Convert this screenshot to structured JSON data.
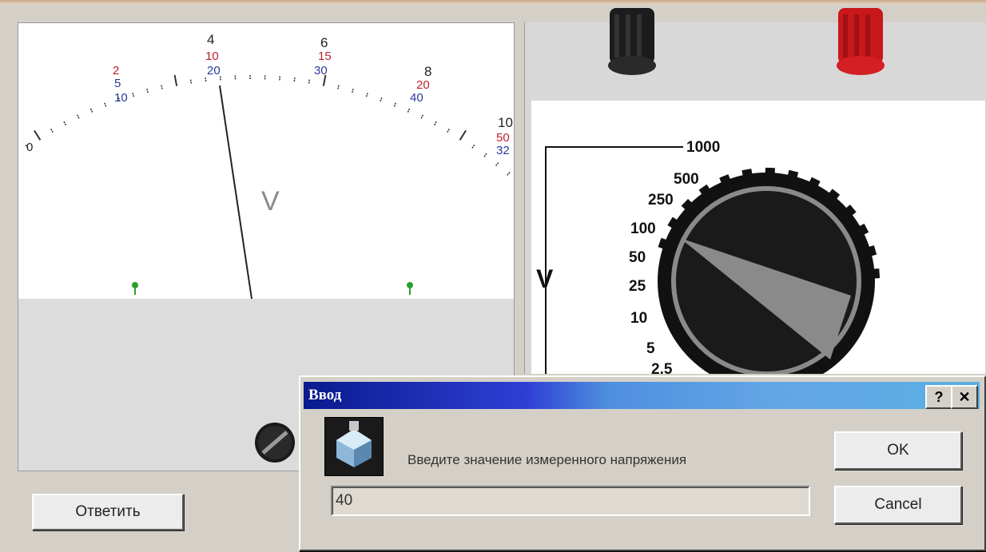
{
  "meter": {
    "unit_label": "V",
    "scales": [
      {
        "name": "top",
        "color": "#222222",
        "ticks": [
          "4",
          "6",
          "8",
          "10"
        ]
      },
      {
        "name": "middle",
        "color": "#c0202a",
        "ticks": [
          "2",
          "10",
          "15",
          "20",
          "50"
        ]
      },
      {
        "name": "inner",
        "color": "#2a3a9a",
        "ticks": [
          "5",
          "10",
          "20",
          "30",
          "40",
          "32"
        ]
      }
    ],
    "zero_label": "0",
    "needle_value": 20,
    "answer_button": "Ответить"
  },
  "switch": {
    "unit_label": "V",
    "ranges": [
      "1000",
      "500",
      "250",
      "100",
      "50",
      "25",
      "10",
      "5",
      "2.5"
    ],
    "selected_range": "100",
    "colors": {
      "knob": "#111111",
      "pointer": "#8a8a8a",
      "terminal_black": "#1c1c1c",
      "terminal_red": "#c8181c"
    }
  },
  "dialog": {
    "title": "Ввод",
    "help_label": "?",
    "close_label": "✕",
    "prompt": "Введите значение измеренного напряжения",
    "input_value": "40",
    "ok_label": "OK",
    "cancel_label": "Cancel"
  }
}
